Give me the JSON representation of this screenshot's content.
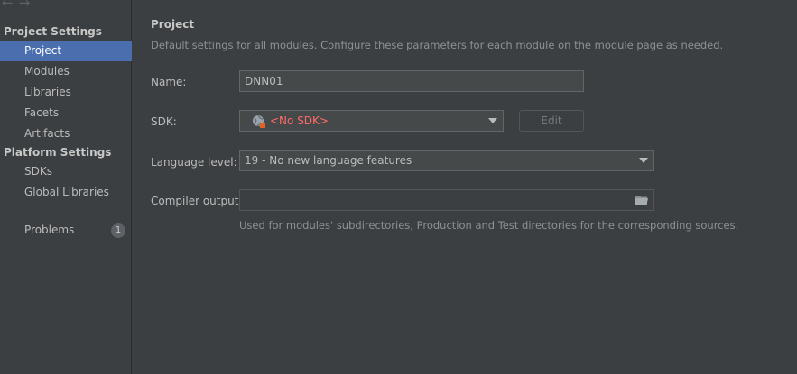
{
  "nav": {
    "back_glyph": "←",
    "forward_glyph": "→"
  },
  "sidebar": {
    "project_settings_header": "Project Settings",
    "project_items": [
      {
        "label": "Project",
        "selected": true
      },
      {
        "label": "Modules"
      },
      {
        "label": "Libraries"
      },
      {
        "label": "Facets"
      },
      {
        "label": "Artifacts"
      }
    ],
    "platform_settings_header": "Platform Settings",
    "platform_items": [
      {
        "label": "SDKs"
      },
      {
        "label": "Global Libraries"
      }
    ],
    "problems": {
      "label": "Problems",
      "count": "1"
    }
  },
  "main": {
    "title": "Project",
    "description": "Default settings for all modules. Configure these parameters for each module on the module page as needed.",
    "name": {
      "label": "Name:",
      "value": "DNN01"
    },
    "sdk": {
      "label": "SDK:",
      "value": "<No SDK>",
      "icon": "globe-sdk-icon",
      "edit_label": "Edit"
    },
    "language_level": {
      "label": "Language level:",
      "value": "19 - No new language features"
    },
    "compiler_output": {
      "label": "Compiler output:",
      "value": "",
      "icon": "folder-icon"
    },
    "hint": "Used for modules' subdirectories, Production and Test directories for the corresponding sources."
  },
  "colors": {
    "accent_selection": "#4b6eaf",
    "error_text": "#ff6b68",
    "background": "#3c3f41"
  }
}
